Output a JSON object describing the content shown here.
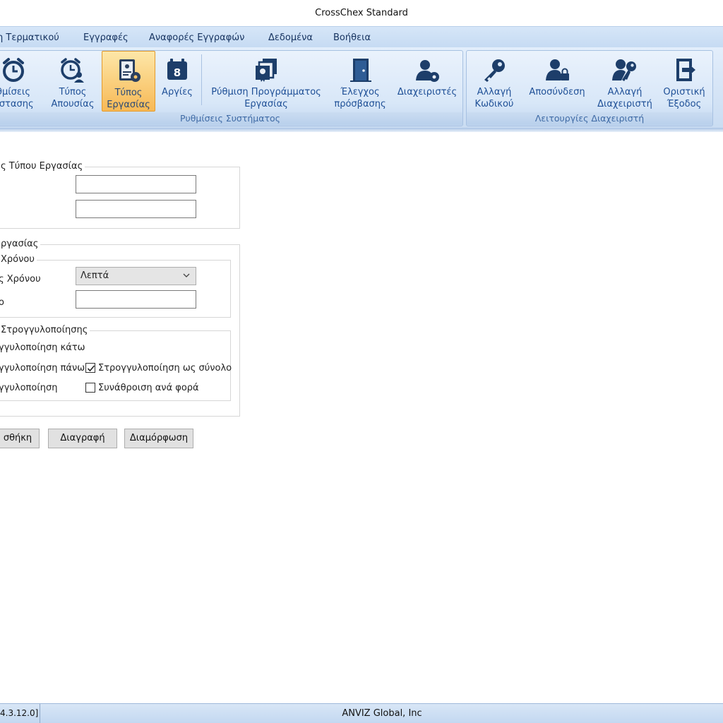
{
  "window": {
    "title": "CrossChex Standard"
  },
  "menu": {
    "items": [
      "η Τερματικού",
      "Εγγραφές",
      "Αναφορές Εγγραφών",
      "Δεδομένα",
      "Βοήθεια"
    ]
  },
  "ribbon": {
    "groups": [
      {
        "caption": "Ρυθμίσεις Συστήματος"
      },
      {
        "caption": "Λειτουργίες Διαχειριστή"
      }
    ],
    "buttons": [
      {
        "line1": "θμίσεις",
        "line2": "άστασης",
        "icon": "alarm-clock-icon"
      },
      {
        "line1": "Τύπος",
        "line2": "Απουσίας",
        "icon": "absence-clock-icon"
      },
      {
        "line1": "Τύπος",
        "line2": "Εργασίας",
        "icon": "work-type-icon"
      },
      {
        "line1": "Αργίες",
        "line2": "",
        "icon": "calendar-icon"
      },
      {
        "line1": "Ρύθμιση Προγράμματος",
        "line2": "Εργασίας",
        "icon": "schedule-icon"
      },
      {
        "line1": "Έλεγχος",
        "line2": "πρόσβασης",
        "icon": "door-icon"
      },
      {
        "line1": "Διαχειριστές",
        "line2": "",
        "icon": "admin-gear-icon"
      },
      {
        "line1": "Αλλαγή",
        "line2": "Κωδικού",
        "icon": "key-icon"
      },
      {
        "line1": "Αποσύνδεση",
        "line2": "",
        "icon": "user-lock-icon"
      },
      {
        "line1": "Αλλαγή",
        "line2": "Διαχειριστή",
        "icon": "user-key-icon"
      },
      {
        "line1": "Οριστική",
        "line2": "Έξοδος",
        "icon": "exit-icon"
      }
    ]
  },
  "form": {
    "section1": {
      "legend": "ς Τύπου Εργασίας",
      "field1_value": "",
      "field2_value": ""
    },
    "section2": {
      "legend": "ργασίας",
      "time_group": {
        "legend": "Χρόνου",
        "unit_label": "ς Χρόνου",
        "unit_selected": "Λεπτά",
        "value_label": "ο",
        "value": ""
      },
      "rounding_group": {
        "legend": "Στρογγυλοποίησης",
        "opt_down": "γγυλοποίηση κάτω",
        "opt_up": "γγυλοποίηση πάνω",
        "opt_none": "γγυλοποίηση",
        "chk_total_label": "Στρογγυλοποίηση ως σύνολο",
        "chk_total_checked": true,
        "chk_each_label": "Συνάθροιση ανά φορά",
        "chk_each_checked": false
      }
    },
    "buttons": {
      "add": "σθήκη",
      "delete": "Διαγραφή",
      "modify": "Διαμόρφωση"
    }
  },
  "status": {
    "version": "4.3.12.0]",
    "company": "ANVIZ Global, Inc"
  },
  "colors": {
    "accent": "#1e4f96",
    "active_button": "#f7b956",
    "ribbon_bg": "#d8e7f8"
  }
}
